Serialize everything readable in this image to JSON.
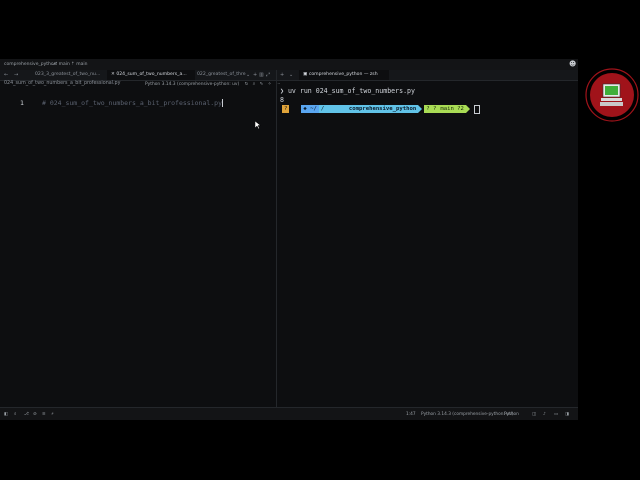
{
  "window": {
    "project": "comprehensive_python",
    "branch": "main",
    "remote": "main"
  },
  "editor": {
    "tabs": [
      {
        "label": "023_3_greatest_of_two_nu..."
      },
      {
        "label": "024_sum_of_two_numbers_a..."
      },
      {
        "label": "022_greatest_of_thre"
      }
    ],
    "interpreter_chip": "Python 3.14.3 (comprehensive-python: uv)",
    "breadcrumb": "024_sum_of_two_numbers_a_bit_professional.py",
    "line_number": "1",
    "line_text": "# 024_sum_of_two_numbers_a_bit_professional.py"
  },
  "terminal": {
    "tab_label": "comprehensive_python — zsh",
    "command": "uv run 024_sum_of_two_numbers.py",
    "output": "8",
    "prompt": {
      "status": "?",
      "home": "~/",
      "slash": "/",
      "dir": "comprehensive_python",
      "git_icons": "? ?",
      "branch": "main ?2"
    }
  },
  "statusbar": {
    "cursor_pos": "1:47",
    "interpreter": "Python 3.14.3 (comprehensive-python: uv)",
    "language": "Python"
  },
  "colors": {
    "accent_blue": "#5aa6f0",
    "prompt_cyan": "#61c3e8",
    "prompt_green": "#a9dc55",
    "logo_red": "#a0131a"
  }
}
